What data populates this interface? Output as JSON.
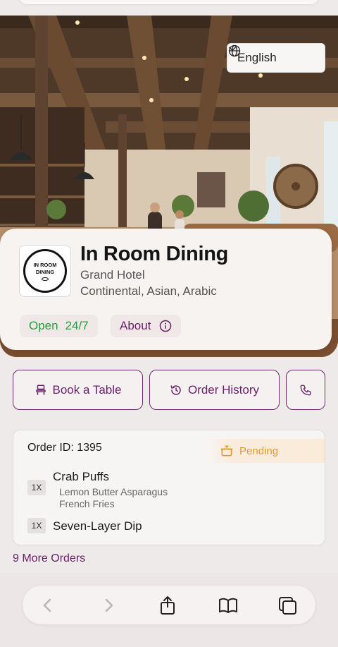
{
  "language_selector": {
    "label": "English",
    "icon": "globe-icon"
  },
  "restaurant": {
    "logo_text_line1": "IN ROOM",
    "logo_text_line2": "DINING",
    "name": "In Room Dining",
    "hotel": "Grand Hotel",
    "cuisines": "Continental, Asian, Arabic",
    "open_label": "Open",
    "hours": "24/7",
    "about_label": "About"
  },
  "actions": {
    "book_table": "Book a Table",
    "order_history": "Order History"
  },
  "order": {
    "id_label": "Order ID: 1395",
    "status": "Pending",
    "items": [
      {
        "qty": "1X",
        "name": "Crab Puffs",
        "addons": [
          "Lemon Butter Asparagus",
          "French Fries"
        ]
      },
      {
        "qty": "1X",
        "name": "Seven-Layer Dip",
        "addons": []
      }
    ]
  },
  "more_orders": "9 More Orders",
  "colors": {
    "brand": "#6a1f6a",
    "open_green": "#2a9a3e",
    "pending_orange": "#e39a2b"
  }
}
